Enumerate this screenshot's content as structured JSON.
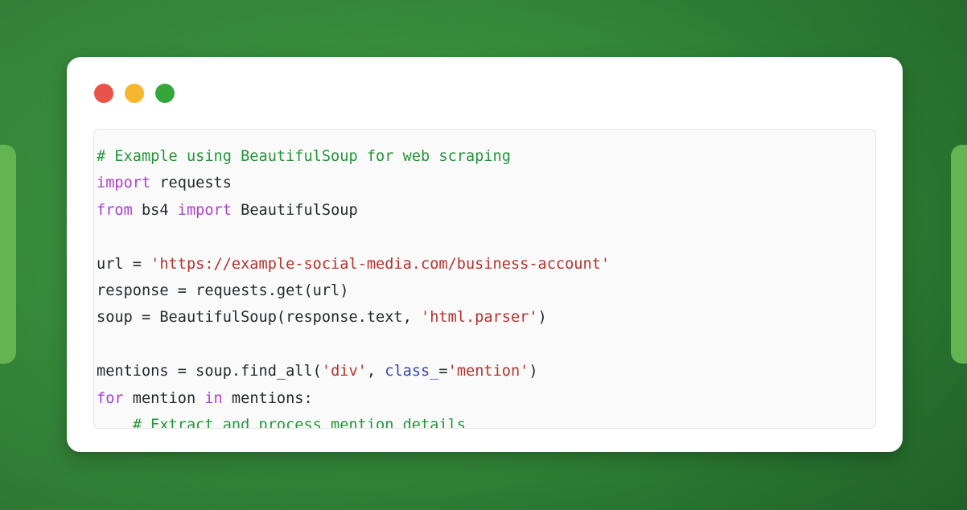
{
  "window": {
    "traffic_lights": [
      {
        "name": "close",
        "color": "#e8544a"
      },
      {
        "name": "minimize",
        "color": "#f5b72f"
      },
      {
        "name": "maximize",
        "color": "#34a63a"
      }
    ]
  },
  "theme": {
    "background_green_dark": "#26702f",
    "background_green_mid": "#35893a",
    "background_green_light": "#3d9440",
    "side_panel_green": "#64b454",
    "card_background": "#ffffff",
    "code_background": "#fafafa",
    "code_border": "#e6e6e6",
    "comment_color": "#22963a",
    "keyword_color": "#a742cc",
    "string_color": "#b3342c",
    "kwarg_color": "#3c46a8",
    "text_color": "#24292e"
  },
  "code": {
    "language": "python",
    "lines": [
      {
        "index": 1,
        "tokens": [
          {
            "type": "comment",
            "text": "# Example using BeautifulSoup for web scraping"
          }
        ]
      },
      {
        "index": 2,
        "tokens": [
          {
            "type": "keyword",
            "text": "import"
          },
          {
            "type": "plain",
            "text": " requests"
          }
        ]
      },
      {
        "index": 3,
        "tokens": [
          {
            "type": "keyword",
            "text": "from"
          },
          {
            "type": "plain",
            "text": " bs4 "
          },
          {
            "type": "keyword",
            "text": "import"
          },
          {
            "type": "plain",
            "text": " BeautifulSoup"
          }
        ]
      },
      {
        "index": 4,
        "tokens": [
          {
            "type": "plain",
            "text": ""
          }
        ]
      },
      {
        "index": 5,
        "tokens": [
          {
            "type": "plain",
            "text": "url = "
          },
          {
            "type": "string",
            "text": "'https://example-social-media.com/business-account'"
          }
        ]
      },
      {
        "index": 6,
        "tokens": [
          {
            "type": "plain",
            "text": "response = requests.get(url)"
          }
        ]
      },
      {
        "index": 7,
        "tokens": [
          {
            "type": "plain",
            "text": "soup = BeautifulSoup(response.text, "
          },
          {
            "type": "string",
            "text": "'html.parser'"
          },
          {
            "type": "plain",
            "text": ")"
          }
        ]
      },
      {
        "index": 8,
        "tokens": [
          {
            "type": "plain",
            "text": ""
          }
        ]
      },
      {
        "index": 9,
        "tokens": [
          {
            "type": "plain",
            "text": "mentions = soup.find_all("
          },
          {
            "type": "string",
            "text": "'div'"
          },
          {
            "type": "plain",
            "text": ", "
          },
          {
            "type": "kwarg",
            "text": "class_"
          },
          {
            "type": "plain",
            "text": "="
          },
          {
            "type": "string",
            "text": "'mention'"
          },
          {
            "type": "plain",
            "text": ")"
          }
        ]
      },
      {
        "index": 10,
        "tokens": [
          {
            "type": "keyword",
            "text": "for"
          },
          {
            "type": "plain",
            "text": " mention "
          },
          {
            "type": "keyword",
            "text": "in"
          },
          {
            "type": "plain",
            "text": " mentions:"
          }
        ]
      },
      {
        "index": 11,
        "tokens": [
          {
            "type": "plain",
            "text": "    "
          },
          {
            "type": "comment",
            "text": "# Extract and process mention details"
          }
        ]
      }
    ]
  }
}
